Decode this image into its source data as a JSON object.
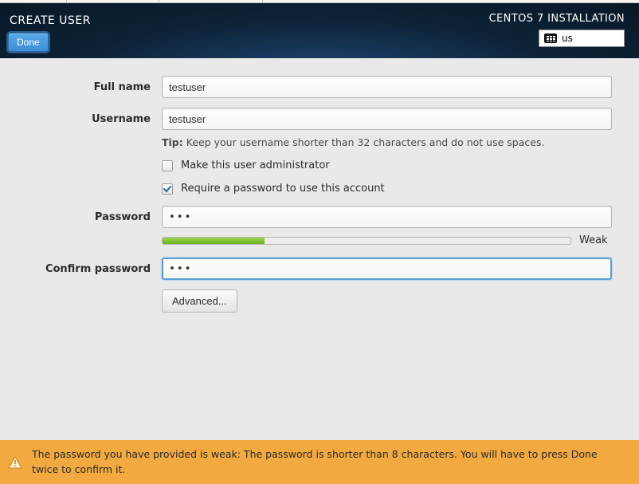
{
  "header": {
    "title": "CREATE USER",
    "done_label": "Done",
    "install_label": "CENTOS 7 INSTALLATION",
    "keyboard_layout": "us"
  },
  "form": {
    "fullname_label": "Full name",
    "fullname_value": "testuser",
    "username_label": "Username",
    "username_value": "testuser",
    "tip_prefix": "Tip:",
    "tip_text": "Keep your username shorter than 32 characters and do not use spaces.",
    "admin_checkbox_label": "Make this user administrator",
    "admin_checked": false,
    "require_password_label": "Require a password to use this account",
    "require_password_checked": true,
    "password_label": "Password",
    "password_value": "•••",
    "strength_label": "Weak",
    "strength_percent": 25,
    "confirm_label": "Confirm password",
    "confirm_value": "•••",
    "advanced_label": "Advanced..."
  },
  "footer": {
    "warning_text": "The password you have provided is weak: The password is shorter than 8 characters. You will have to press Done twice to confirm it."
  }
}
